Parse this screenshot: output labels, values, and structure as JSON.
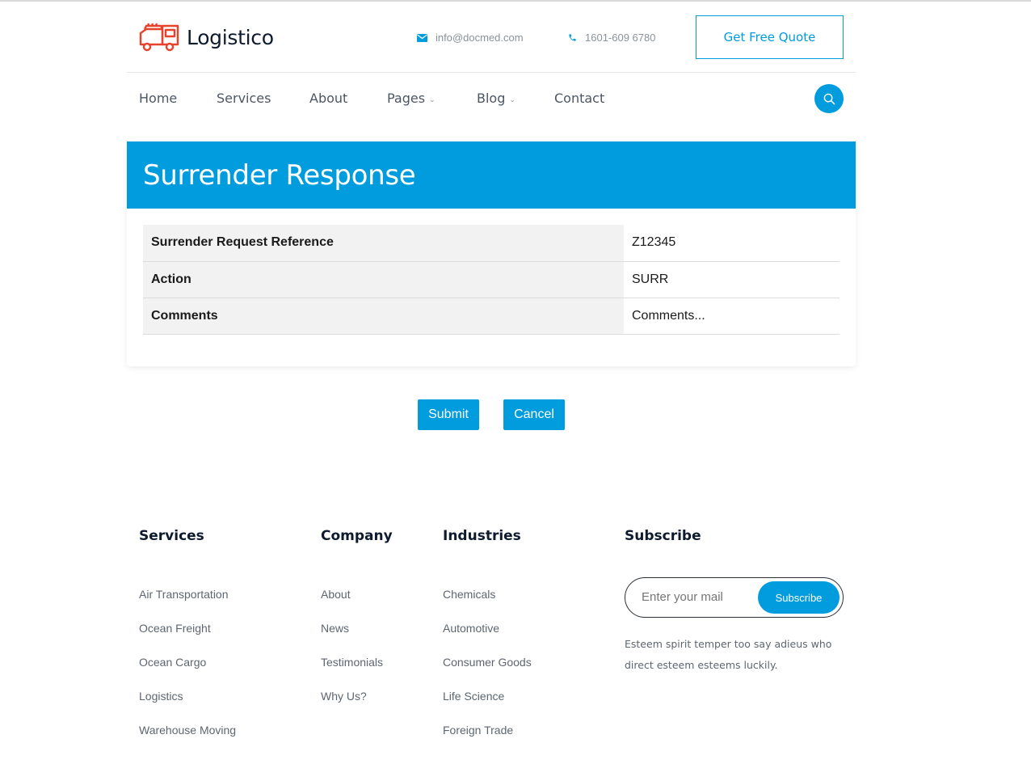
{
  "header": {
    "brand": "Logistico",
    "email": "info@docmed.com",
    "phone": "1601-609 6780",
    "quote_label": "Get Free Quote"
  },
  "nav": {
    "items": [
      {
        "label": "Home"
      },
      {
        "label": "Services"
      },
      {
        "label": "About"
      },
      {
        "label": "Pages",
        "dropdown": true
      },
      {
        "label": "Blog",
        "dropdown": true
      },
      {
        "label": "Contact"
      }
    ],
    "search_icon": "search-icon"
  },
  "main": {
    "title": "Surrender Response",
    "rows": [
      {
        "label": "Surrender Request Reference",
        "value": "Z12345"
      },
      {
        "label": "Action",
        "value": "SURR"
      },
      {
        "label": "Comments",
        "value": "Comments..."
      }
    ],
    "submit_label": "Submit",
    "cancel_label": "Cancel"
  },
  "footer": {
    "services": {
      "heading": "Services",
      "links": [
        "Air Transportation",
        "Ocean Freight",
        "Ocean Cargo",
        "Logistics",
        "Warehouse Moving"
      ]
    },
    "company": {
      "heading": "Company",
      "links": [
        "About",
        "News",
        "Testimonials",
        "Why Us?"
      ]
    },
    "industries": {
      "heading": "Industries",
      "links": [
        "Chemicals",
        "Automotive",
        "Consumer Goods",
        "Life Science",
        "Foreign Trade"
      ]
    },
    "subscribe": {
      "heading": "Subscribe",
      "placeholder": "Enter your mail",
      "button_label": "Subscribe",
      "text": "Esteem spirit temper too say adieus who direct esteem esteems luckily."
    }
  },
  "colors": {
    "accent": "#009cde",
    "logo": "#e8412c",
    "heading": "#0e1b2e"
  }
}
